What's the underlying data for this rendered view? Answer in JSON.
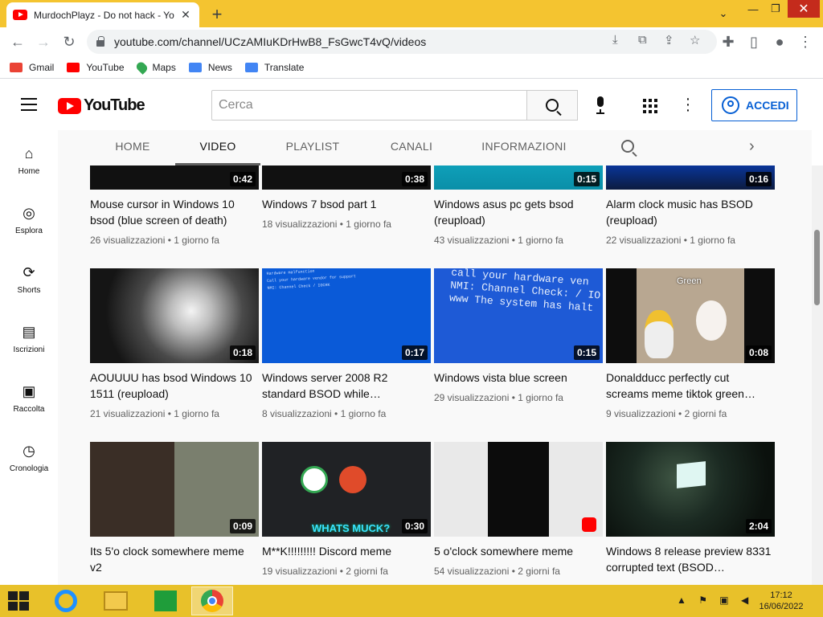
{
  "browser": {
    "tab_title": "MurdochPlayz - Do not hack - Yo",
    "tab_close": "✕",
    "new_tab": "+",
    "url": "youtube.com/channel/UCzAMIuKDrHwB8_FsGwcT4vQ/videos",
    "window_controls": {
      "dropdown": "⌄",
      "minimize": "—",
      "maximize": "❐",
      "close": "✕"
    }
  },
  "bookmarks": [
    {
      "label": "Gmail",
      "color": "#ea4335"
    },
    {
      "label": "YouTube",
      "color": "#ff0000"
    },
    {
      "label": "Maps",
      "color": "#34a853"
    },
    {
      "label": "News",
      "color": "#4285f4"
    },
    {
      "label": "Translate",
      "color": "#4285f4"
    }
  ],
  "youtube": {
    "logo_text": "YouTube",
    "search_placeholder": "Cerca",
    "sign_in_label": "ACCEDI"
  },
  "guide": [
    {
      "label": "Home",
      "icon": "home-icon",
      "glyph": "⌂"
    },
    {
      "label": "Esplora",
      "icon": "compass-icon",
      "glyph": "◎"
    },
    {
      "label": "Shorts",
      "icon": "shorts-icon",
      "glyph": "⟳"
    },
    {
      "label": "Iscrizioni",
      "icon": "subscriptions-icon",
      "glyph": "▤"
    },
    {
      "label": "Raccolta",
      "icon": "library-icon",
      "glyph": "▣"
    },
    {
      "label": "Cronologia",
      "icon": "history-icon",
      "glyph": "◷"
    }
  ],
  "channel_tabs": [
    {
      "label": "HOME",
      "active": false
    },
    {
      "label": "VIDEO",
      "active": true
    },
    {
      "label": "PLAYLIST",
      "active": false
    },
    {
      "label": "CANALI",
      "active": false
    },
    {
      "label": "INFORMAZIONI",
      "active": false
    }
  ],
  "channel_next": "›",
  "videos": [
    {
      "title": "Mouse cursor in Windows 10 bsod (blue screen of death)",
      "views": "26 visualizzazioni",
      "age": "1 giorno fa",
      "duration": "0:42",
      "thumb": "dark"
    },
    {
      "title": "Windows 7 bsod part 1",
      "views": "18 visualizzazioni",
      "age": "1 giorno fa",
      "duration": "0:38",
      "thumb": "dark"
    },
    {
      "title": "Windows asus pc gets bsod (reupload)",
      "views": "43 visualizzazioni",
      "age": "1 giorno fa",
      "duration": "0:15",
      "thumb": "cyan"
    },
    {
      "title": "Alarm clock music has BSOD (reupload)",
      "views": "22 visualizzazioni",
      "age": "1 giorno fa",
      "duration": "0:16",
      "thumb": "bluedark"
    },
    {
      "title": "AOUUUU has bsod Windows 10 1511 (reupload)",
      "views": "21 visualizzazioni",
      "age": "1 giorno fa",
      "duration": "0:18",
      "thumb": "monitor"
    },
    {
      "title": "Windows server 2008 R2 standard BSOD while…",
      "views": "8 visualizzazioni",
      "age": "1 giorno fa",
      "duration": "0:17",
      "thumb": "bsodblue"
    },
    {
      "title": "Windows vista blue screen",
      "views": "29 visualizzazioni",
      "age": "1 giorno fa",
      "duration": "0:15",
      "thumb": "bsodtext"
    },
    {
      "title": "Donaldducc perfectly cut screams meme tiktok green…",
      "views": "9 visualizzazioni",
      "age": "2 giorni fa",
      "duration": "0:08",
      "thumb": "duck"
    },
    {
      "title": "Its 5'o clock somewhere meme v2",
      "views": "",
      "age": "",
      "duration": "0:09",
      "thumb": "face"
    },
    {
      "title": "M**K!!!!!!!!! Discord meme",
      "views": "19 visualizzazioni",
      "age": "2 giorni fa",
      "duration": "0:30",
      "thumb": "discord"
    },
    {
      "title": "5 o'clock somewhere meme",
      "views": "54 visualizzazioni",
      "age": "2 giorni fa",
      "duration": "",
      "thumb": "phone"
    },
    {
      "title": "Windows 8 release preview 8331 corrupted text (BSOD…",
      "views": "",
      "age": "",
      "duration": "2:04",
      "thumb": "room"
    }
  ],
  "thumb_text": {
    "bsodtext": "call your hardware ven\nNMI: Channel Check: / IO\nwww The system has halt",
    "bsodblue": "Hardware malfunction\nCall your hardware vendor for support\nNMI: Channel Check / IOCHK",
    "duck_caption": "Green",
    "discord_caption": "WHATS MUCK?"
  },
  "taskbar": {
    "time": "17:12",
    "date": "16/06/2022",
    "tray": "▲ ⚑ ▣ ◀"
  }
}
